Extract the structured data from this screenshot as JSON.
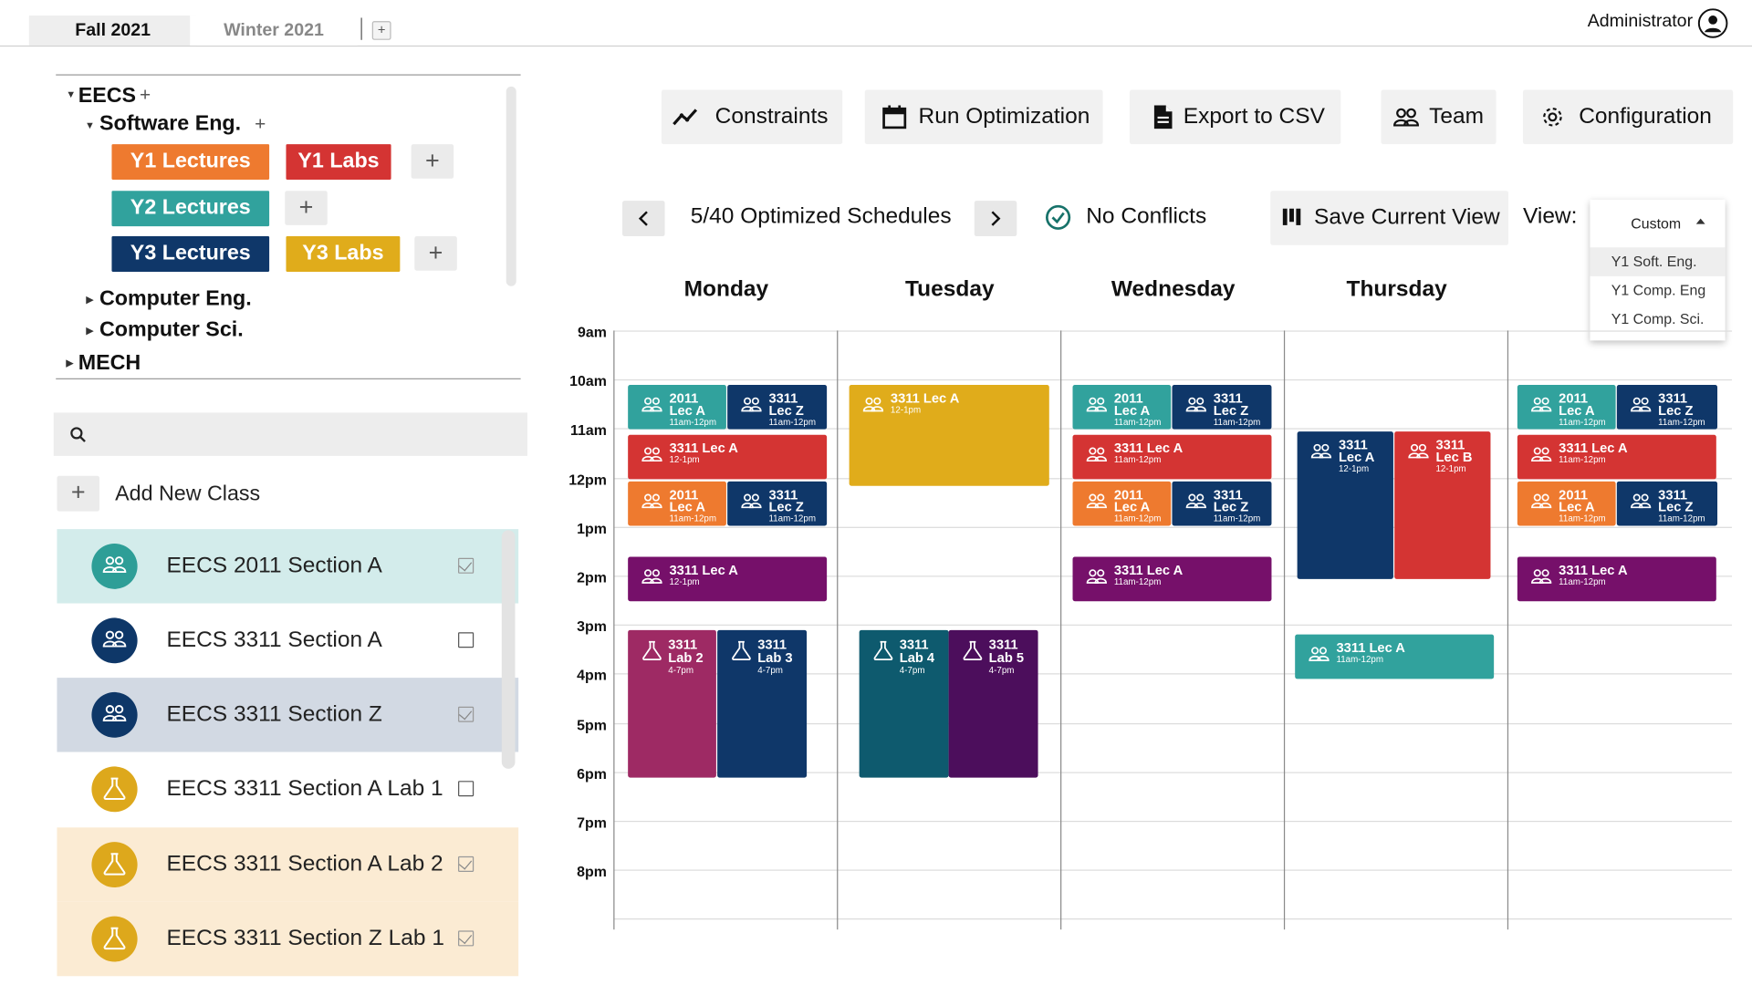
{
  "terms": {
    "active": "Fall 2021",
    "other": "Winter 2021",
    "add": "+"
  },
  "user": {
    "name": "Administrator",
    "icon": "user-circle-icon"
  },
  "tree": {
    "eecs": "EECS",
    "software": "Software Eng.",
    "computer_eng": "Computer Eng.",
    "computer_sci": "Computer Sci.",
    "mech": "MECH",
    "plus": "+",
    "groups": [
      {
        "label": "Y1 Lectures",
        "color": "#EE7A2F"
      },
      {
        "label": "Y1 Labs",
        "color": "#D43433"
      },
      {
        "label": "Y2 Lectures",
        "color": "#31A29D"
      },
      {
        "label": "Y3 Lectures",
        "color": "#0F3769"
      },
      {
        "label": "Y3 Labs",
        "color": "#E0AC1B"
      }
    ]
  },
  "search": {
    "placeholder": "",
    "icon": "search-icon"
  },
  "add_class": {
    "label": "Add New Class",
    "plus": "+"
  },
  "classes": [
    {
      "label": "EECS 2011 Section A",
      "icon": "people-icon",
      "checked": true,
      "bg": "#D3ECEB",
      "circle": "#2E9E97"
    },
    {
      "label": "EECS 3311 Section A",
      "icon": "people-icon",
      "checked": false,
      "bg": "#FFFFFF",
      "circle": "#0E3768"
    },
    {
      "label": "EECS 3311 Section Z",
      "icon": "people-icon",
      "checked": true,
      "bg": "#D2D9E3",
      "circle": "#0E3768"
    },
    {
      "label": "EECS 3311 Section A Lab 1",
      "icon": "flask-icon",
      "checked": false,
      "bg": "#FFFFFF",
      "circle": "#DDA81C"
    },
    {
      "label": "EECS 3311 Section A Lab 2",
      "icon": "flask-icon",
      "checked": true,
      "bg": "#FBEBD3",
      "circle": "#DDA81C"
    },
    {
      "label": "EECS 3311 Section Z Lab 1",
      "icon": "flask-icon",
      "checked": true,
      "bg": "#FBEBD3",
      "circle": "#DDA81C"
    }
  ],
  "toolbar": {
    "constraints": "Constraints",
    "run": "Run Optimization",
    "export": "Export to CSV",
    "team": "Team",
    "config": "Configuration"
  },
  "nav": {
    "schedules": "5/40 Optimized Schedules",
    "conflicts": "No Conflicts",
    "save_view": "Save Current View",
    "view_label": "View:",
    "view_current": "Custom",
    "view_options": [
      "Y1 Soft. Eng.",
      "Y1 Comp. Eng",
      "Y1 Comp. Sci."
    ]
  },
  "days": [
    "Monday",
    "Tuesday",
    "Wednesday",
    "Thursday"
  ],
  "times": [
    "9am",
    "10am",
    "11am",
    "12pm",
    "1pm",
    "2pm",
    "3pm",
    "4pm",
    "5pm",
    "6pm",
    "7pm",
    "8pm"
  ],
  "events": [
    {
      "kind": "lec",
      "l1": "2011",
      "l2": "Lec A",
      "time": "11am-12pm",
      "color": "#31A29D"
    },
    {
      "kind": "lec",
      "l1": "3311",
      "l2": "Lec Z",
      "time": "11am-12pm",
      "color": "#0F3769"
    },
    {
      "kind": "lec",
      "l1": "3311 Lec A",
      "l2": "",
      "time": "12-1pm",
      "color": "#D43433"
    },
    {
      "kind": "lec",
      "l1": "2011",
      "l2": "Lec A",
      "time": "11am-12pm",
      "color": "#EE7A2F"
    },
    {
      "kind": "lec",
      "l1": "3311",
      "l2": "Lec Z",
      "time": "11am-12pm",
      "color": "#0F3769"
    },
    {
      "kind": "lec",
      "l1": "3311 Lec A",
      "l2": "",
      "time": "12-1pm",
      "color": "#76106A"
    },
    {
      "kind": "lab",
      "l1": "3311",
      "l2": "Lab 2",
      "time": "4-7pm",
      "color": "#9E2A64"
    },
    {
      "kind": "lab",
      "l1": "3311",
      "l2": "Lab 3",
      "time": "4-7pm",
      "color": "#0F3769"
    },
    {
      "kind": "lec",
      "l1": "3311 Lec A",
      "l2": "",
      "time": "12-1pm",
      "color": "#E0AC1B"
    },
    {
      "kind": "lab",
      "l1": "3311",
      "l2": "Lab 4",
      "time": "4-7pm",
      "color": "#0E5A6E"
    },
    {
      "kind": "lab",
      "l1": "3311",
      "l2": "Lab 5",
      "time": "4-7pm",
      "color": "#4C0E5C"
    },
    {
      "kind": "lec",
      "l1": "2011",
      "l2": "Lec A",
      "time": "11am-12pm",
      "color": "#31A29D"
    },
    {
      "kind": "lec",
      "l1": "3311",
      "l2": "Lec Z",
      "time": "11am-12pm",
      "color": "#0F3769"
    },
    {
      "kind": "lec",
      "l1": "3311 Lec A",
      "l2": "",
      "time": "11am-12pm",
      "color": "#D43433"
    },
    {
      "kind": "lec",
      "l1": "2011",
      "l2": "Lec A",
      "time": "11am-12pm",
      "color": "#EE7A2F"
    },
    {
      "kind": "lec",
      "l1": "3311",
      "l2": "Lec Z",
      "time": "11am-12pm",
      "color": "#0F3769"
    },
    {
      "kind": "lec",
      "l1": "3311 Lec A",
      "l2": "",
      "time": "11am-12pm",
      "color": "#76106A"
    },
    {
      "kind": "lec",
      "l1": "3311",
      "l2": "Lec A",
      "time": "12-1pm",
      "color": "#0F3769"
    },
    {
      "kind": "lec",
      "l1": "3311",
      "l2": "Lec B",
      "time": "12-1pm",
      "color": "#D43433"
    },
    {
      "kind": "lec",
      "l1": "3311 Lec A",
      "l2": "",
      "time": "11am-12pm",
      "color": "#31A29D"
    },
    {
      "kind": "lec",
      "l1": "2011",
      "l2": "Lec A",
      "time": "11am-12pm",
      "color": "#31A29D"
    },
    {
      "kind": "lec",
      "l1": "3311",
      "l2": "Lec Z",
      "time": "11am-12pm",
      "color": "#0F3769"
    },
    {
      "kind": "lec",
      "l1": "3311 Lec A",
      "l2": "",
      "time": "11am-12pm",
      "color": "#D43433"
    },
    {
      "kind": "lec",
      "l1": "2011",
      "l2": "Lec A",
      "time": "11am-12pm",
      "color": "#EE7A2F"
    },
    {
      "kind": "lec",
      "l1": "3311",
      "l2": "Lec Z",
      "time": "11am-12pm",
      "color": "#0F3769"
    },
    {
      "kind": "lec",
      "l1": "3311 Lec A",
      "l2": "",
      "time": "11am-12pm",
      "color": "#76106A"
    }
  ]
}
